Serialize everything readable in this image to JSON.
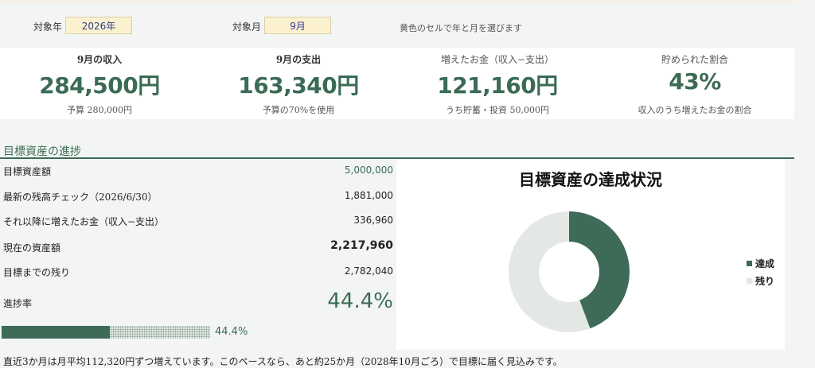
{
  "controls": {
    "year_label": "対象年",
    "year_value": "2026年",
    "month_label": "対象月",
    "month_value": "9月",
    "hint": "黄色のセルで年と月を選びます"
  },
  "kpis": [
    {
      "title": "9月の収入",
      "value": "284,500円",
      "note": "予算 280,000円"
    },
    {
      "title": "9月の支出",
      "value": "163,340円",
      "note": "予算の70%を使用"
    },
    {
      "title": "増えたお金（収入−支出）",
      "value": "121,160円",
      "note": "うち貯蓄・投資 50,000円"
    },
    {
      "title": "貯められた割合",
      "value": "43%",
      "note": "収入のうち増えたお金の割合"
    }
  ],
  "goal": {
    "section_title": "目標資産の進捗",
    "rows": [
      {
        "label": "目標資産額",
        "value": "5,000,000"
      },
      {
        "label": "最新の残高チェック（2026/6/30）",
        "value": "1,881,000"
      },
      {
        "label": "それ以降に増えたお金（収入−支出）",
        "value": "336,960"
      },
      {
        "label": "現在の資産額",
        "value": "2,217,960"
      },
      {
        "label": "目標までの残り",
        "value": "2,782,040"
      },
      {
        "label": "進捗率",
        "value": "44.4%"
      }
    ],
    "progress_fraction": 0.444,
    "progress_label": "44.4%"
  },
  "chart_data": {
    "type": "pie",
    "title": "目標資産の達成状況",
    "categories": [
      "達成",
      "残り"
    ],
    "values": [
      2217960,
      2782040
    ],
    "colors": [
      "#3d6b58",
      "#e3e8e5"
    ],
    "donut": true,
    "legend_position": "right"
  },
  "footer": "直近3か月は月平均112,320円ずつ増えています。このペースなら、あと約25か月（2028年10月ごろ）で目標に届く見込みです。"
}
